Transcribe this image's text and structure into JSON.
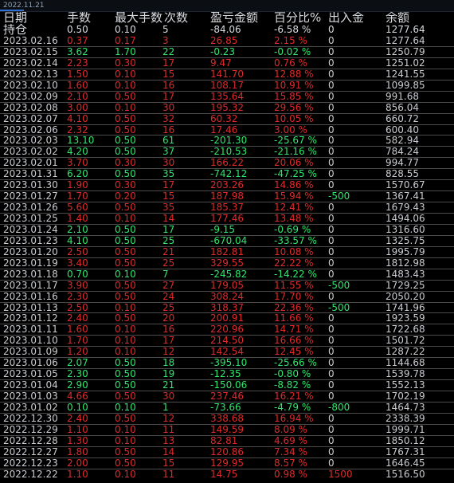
{
  "window": {
    "date_label": "2022.11.21",
    "accent": "#2f6fd6"
  },
  "colors": {
    "profit": "#2ee86a",
    "loss": "#e02a2a",
    "neutral": "#c9ccd1",
    "background": "#000000"
  },
  "table": {
    "headers": [
      "日期",
      "手数",
      "最大手数",
      "次数",
      "盈亏金额",
      "百分比%",
      "出入金",
      "余额"
    ],
    "position_row": {
      "label": "持仓",
      "lots": "0.50",
      "max_lots": "0.10",
      "count": "5",
      "pnl": "-84.06",
      "pct": "-6.58 %",
      "flow": "0",
      "balance": "1277.64",
      "sign": "pos"
    },
    "rows": [
      {
        "date": "2023.02.16",
        "lots": "0.37",
        "max_lots": "0.17",
        "count": "3",
        "pnl": "26.85",
        "pct": "2.15 %",
        "flow": "0",
        "balance": "1277.64",
        "sign": "neg"
      },
      {
        "date": "2023.02.15",
        "lots": "3.62",
        "max_lots": "1.70",
        "count": "22",
        "pnl": "-0.23",
        "pct": "-0.02 %",
        "flow": "0",
        "balance": "1250.79",
        "sign": "pos"
      },
      {
        "date": "2023.02.14",
        "lots": "2.23",
        "max_lots": "0.30",
        "count": "17",
        "pnl": "9.47",
        "pct": "0.76 %",
        "flow": "0",
        "balance": "1251.02",
        "sign": "neg"
      },
      {
        "date": "2023.02.13",
        "lots": "1.50",
        "max_lots": "0.10",
        "count": "15",
        "pnl": "141.70",
        "pct": "12.88 %",
        "flow": "0",
        "balance": "1241.55",
        "sign": "neg"
      },
      {
        "date": "2023.02.10",
        "lots": "1.60",
        "max_lots": "0.10",
        "count": "16",
        "pnl": "108.17",
        "pct": "10.91 %",
        "flow": "0",
        "balance": "1099.85",
        "sign": "neg"
      },
      {
        "date": "2023.02.09",
        "lots": "2.10",
        "max_lots": "0.50",
        "count": "17",
        "pnl": "135.64",
        "pct": "15.85 %",
        "flow": "0",
        "balance": "991.68",
        "sign": "neg"
      },
      {
        "date": "2023.02.08",
        "lots": "3.00",
        "max_lots": "0.10",
        "count": "30",
        "pnl": "195.32",
        "pct": "29.56 %",
        "flow": "0",
        "balance": "856.04",
        "sign": "neg"
      },
      {
        "date": "2023.02.07",
        "lots": "4.10",
        "max_lots": "0.50",
        "count": "32",
        "pnl": "60.32",
        "pct": "10.05 %",
        "flow": "0",
        "balance": "660.72",
        "sign": "neg"
      },
      {
        "date": "2023.02.06",
        "lots": "2.32",
        "max_lots": "0.50",
        "count": "16",
        "pnl": "17.46",
        "pct": "3.00 %",
        "flow": "0",
        "balance": "600.40",
        "sign": "neg"
      },
      {
        "date": "2023.02.03",
        "lots": "13.10",
        "max_lots": "0.50",
        "count": "61",
        "pnl": "-201.30",
        "pct": "-25.67 %",
        "flow": "0",
        "balance": "582.94",
        "sign": "pos"
      },
      {
        "date": "2023.02.02",
        "lots": "4.20",
        "max_lots": "0.50",
        "count": "37",
        "pnl": "-210.53",
        "pct": "-21.16 %",
        "flow": "0",
        "balance": "784.24",
        "sign": "pos"
      },
      {
        "date": "2023.02.01",
        "lots": "3.70",
        "max_lots": "0.30",
        "count": "30",
        "pnl": "166.22",
        "pct": "20.06 %",
        "flow": "0",
        "balance": "994.77",
        "sign": "neg"
      },
      {
        "date": "2023.01.31",
        "lots": "6.20",
        "max_lots": "0.50",
        "count": "35",
        "pnl": "-742.12",
        "pct": "-47.25 %",
        "flow": "0",
        "balance": "828.55",
        "sign": "pos"
      },
      {
        "date": "2023.01.30",
        "lots": "1.90",
        "max_lots": "0.30",
        "count": "17",
        "pnl": "203.26",
        "pct": "14.86 %",
        "flow": "0",
        "balance": "1570.67",
        "sign": "neg"
      },
      {
        "date": "2023.01.27",
        "lots": "1.70",
        "max_lots": "0.20",
        "count": "15",
        "pnl": "187.98",
        "pct": "15.94 %",
        "flow": "-500",
        "balance": "1367.41",
        "sign": "neg"
      },
      {
        "date": "2023.01.26",
        "lots": "5.60",
        "max_lots": "0.50",
        "count": "35",
        "pnl": "185.37",
        "pct": "12.41 %",
        "flow": "0",
        "balance": "1679.43",
        "sign": "neg"
      },
      {
        "date": "2023.01.25",
        "lots": "1.40",
        "max_lots": "0.10",
        "count": "14",
        "pnl": "177.46",
        "pct": "13.48 %",
        "flow": "0",
        "balance": "1494.06",
        "sign": "neg"
      },
      {
        "date": "2023.01.24",
        "lots": "2.10",
        "max_lots": "0.50",
        "count": "17",
        "pnl": "-9.15",
        "pct": "-0.69 %",
        "flow": "0",
        "balance": "1316.60",
        "sign": "pos"
      },
      {
        "date": "2023.01.23",
        "lots": "4.10",
        "max_lots": "0.50",
        "count": "25",
        "pnl": "-670.04",
        "pct": "-33.57 %",
        "flow": "0",
        "balance": "1325.75",
        "sign": "pos"
      },
      {
        "date": "2023.01.20",
        "lots": "2.50",
        "max_lots": "0.50",
        "count": "21",
        "pnl": "182.81",
        "pct": "10.08 %",
        "flow": "0",
        "balance": "1995.79",
        "sign": "neg"
      },
      {
        "date": "2023.01.19",
        "lots": "3.40",
        "max_lots": "0.50",
        "count": "25",
        "pnl": "329.55",
        "pct": "22.22 %",
        "flow": "0",
        "balance": "1812.98",
        "sign": "neg"
      },
      {
        "date": "2023.01.18",
        "lots": "0.70",
        "max_lots": "0.10",
        "count": "7",
        "pnl": "-245.82",
        "pct": "-14.22 %",
        "flow": "0",
        "balance": "1483.43",
        "sign": "pos"
      },
      {
        "date": "2023.01.17",
        "lots": "3.90",
        "max_lots": "0.50",
        "count": "27",
        "pnl": "179.05",
        "pct": "11.55 %",
        "flow": "-500",
        "balance": "1729.25",
        "sign": "neg"
      },
      {
        "date": "2023.01.16",
        "lots": "2.30",
        "max_lots": "0.50",
        "count": "24",
        "pnl": "308.24",
        "pct": "17.70 %",
        "flow": "0",
        "balance": "2050.20",
        "sign": "neg"
      },
      {
        "date": "2023.01.13",
        "lots": "2.50",
        "max_lots": "0.10",
        "count": "25",
        "pnl": "318.37",
        "pct": "22.36 %",
        "flow": "-500",
        "balance": "1741.96",
        "sign": "neg"
      },
      {
        "date": "2023.01.12",
        "lots": "2.40",
        "max_lots": "0.50",
        "count": "20",
        "pnl": "200.91",
        "pct": "11.66 %",
        "flow": "0",
        "balance": "1923.59",
        "sign": "neg"
      },
      {
        "date": "2023.01.11",
        "lots": "1.60",
        "max_lots": "0.10",
        "count": "16",
        "pnl": "220.96",
        "pct": "14.71 %",
        "flow": "0",
        "balance": "1722.68",
        "sign": "neg"
      },
      {
        "date": "2023.01.10",
        "lots": "1.70",
        "max_lots": "0.10",
        "count": "17",
        "pnl": "214.50",
        "pct": "16.66 %",
        "flow": "0",
        "balance": "1501.72",
        "sign": "neg"
      },
      {
        "date": "2023.01.09",
        "lots": "1.20",
        "max_lots": "0.10",
        "count": "12",
        "pnl": "142.54",
        "pct": "12.45 %",
        "flow": "0",
        "balance": "1287.22",
        "sign": "neg"
      },
      {
        "date": "2023.01.06",
        "lots": "2.07",
        "max_lots": "0.50",
        "count": "18",
        "pnl": "-395.10",
        "pct": "-25.66 %",
        "flow": "0",
        "balance": "1144.68",
        "sign": "pos"
      },
      {
        "date": "2023.01.05",
        "lots": "2.30",
        "max_lots": "0.50",
        "count": "19",
        "pnl": "-12.35",
        "pct": "-0.80 %",
        "flow": "0",
        "balance": "1539.78",
        "sign": "pos"
      },
      {
        "date": "2023.01.04",
        "lots": "2.90",
        "max_lots": "0.50",
        "count": "21",
        "pnl": "-150.06",
        "pct": "-8.82 %",
        "flow": "0",
        "balance": "1552.13",
        "sign": "pos"
      },
      {
        "date": "2023.01.03",
        "lots": "4.66",
        "max_lots": "0.50",
        "count": "30",
        "pnl": "237.46",
        "pct": "16.21 %",
        "flow": "0",
        "balance": "1702.19",
        "sign": "neg"
      },
      {
        "date": "2023.01.02",
        "lots": "0.10",
        "max_lots": "0.10",
        "count": "1",
        "pnl": "-73.66",
        "pct": "-4.79 %",
        "flow": "-800",
        "balance": "1464.73",
        "sign": "pos"
      },
      {
        "date": "2022.12.30",
        "lots": "2.40",
        "max_lots": "0.50",
        "count": "12",
        "pnl": "338.68",
        "pct": "16.94 %",
        "flow": "0",
        "balance": "2338.39",
        "sign": "neg"
      },
      {
        "date": "2022.12.29",
        "lots": "1.10",
        "max_lots": "0.10",
        "count": "11",
        "pnl": "149.59",
        "pct": "8.09 %",
        "flow": "0",
        "balance": "1999.71",
        "sign": "neg"
      },
      {
        "date": "2022.12.28",
        "lots": "1.30",
        "max_lots": "0.10",
        "count": "13",
        "pnl": "82.81",
        "pct": "4.69 %",
        "flow": "0",
        "balance": "1850.12",
        "sign": "neg"
      },
      {
        "date": "2022.12.27",
        "lots": "1.80",
        "max_lots": "0.50",
        "count": "14",
        "pnl": "120.86",
        "pct": "7.34 %",
        "flow": "0",
        "balance": "1767.31",
        "sign": "neg"
      },
      {
        "date": "2022.12.23",
        "lots": "2.00",
        "max_lots": "0.50",
        "count": "15",
        "pnl": "129.95",
        "pct": "8.57 %",
        "flow": "0",
        "balance": "1646.45",
        "sign": "neg"
      },
      {
        "date": "2022.12.22",
        "lots": "1.10",
        "max_lots": "0.10",
        "count": "11",
        "pnl": "14.75",
        "pct": "0.98 %",
        "flow": "1500",
        "balance": "1516.50",
        "sign": "neg"
      }
    ]
  }
}
